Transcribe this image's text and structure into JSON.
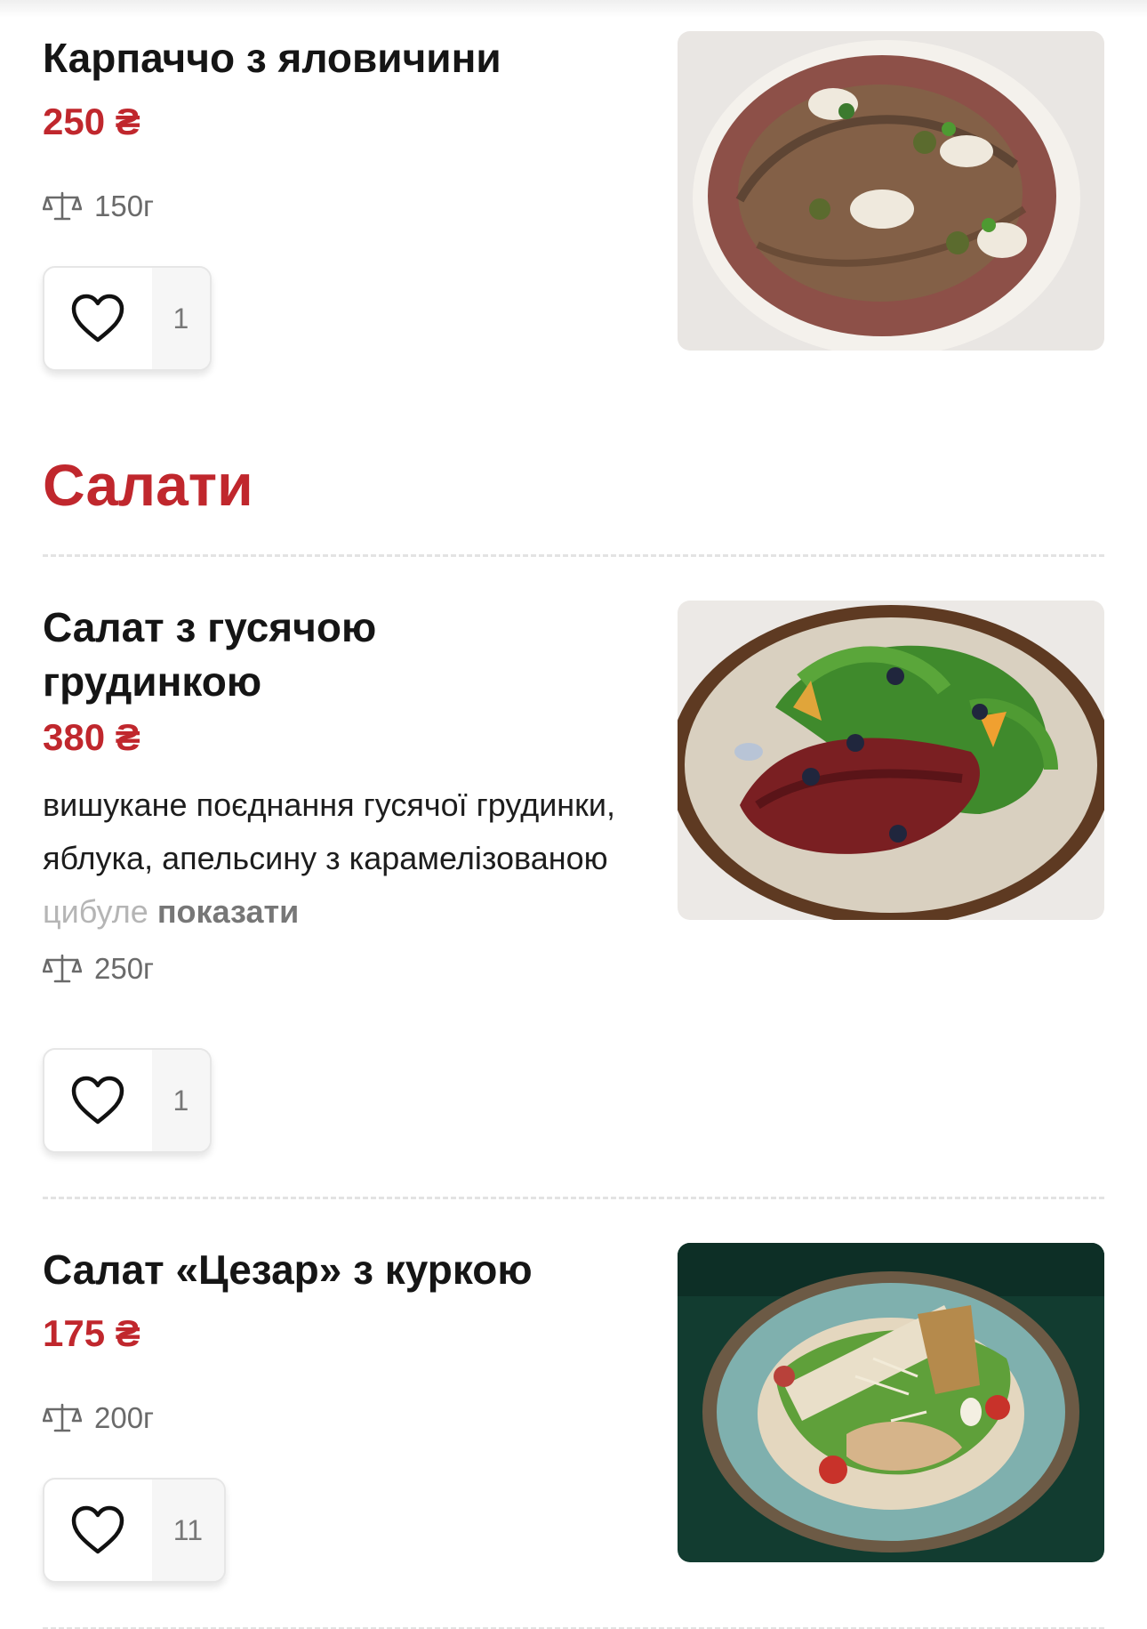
{
  "section": {
    "title": "Салати"
  },
  "dishes": [
    {
      "name": "Карпаччо з яловичини",
      "price": "250 ₴",
      "weight": "150г",
      "likes": "1"
    },
    {
      "name": "Салат з гусячою грудинкою",
      "price": "380 ₴",
      "description_main": "вишукане поєднання гусячої грудинки, яблука, апельсину з карамелізованою ",
      "description_faded": "цибуле",
      "show_more": "показати",
      "weight": "250г",
      "likes": "1"
    },
    {
      "name": "Салат «Цезар» з куркою",
      "price": "175 ₴",
      "weight": "200г",
      "likes": "11"
    }
  ],
  "icons": {
    "weight": "scales-icon",
    "like": "heart-icon"
  },
  "colors": {
    "accent": "#c0272d",
    "muted": "#6a6a6a"
  }
}
